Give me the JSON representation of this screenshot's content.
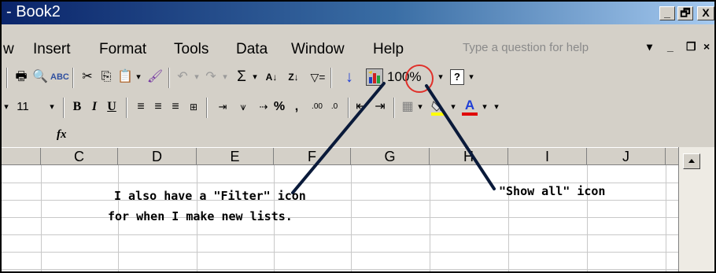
{
  "window": {
    "title": "- Book2",
    "minimize": "_",
    "restore": "̸",
    "close": "X"
  },
  "menu": {
    "items": [
      "w",
      "Insert",
      "Format",
      "Tools",
      "Data",
      "Window",
      "Help"
    ],
    "help_placeholder": "Type a question for help",
    "mdi": [
      "▾",
      "_",
      "̸",
      "×"
    ]
  },
  "standard_toolbar": {
    "zoom": "100%"
  },
  "formatting_toolbar": {
    "font_size": "11",
    "bold": "B",
    "italic": "I",
    "underline": "U",
    "percent": "%",
    "comma": ",",
    "font_color": "A"
  },
  "formula_bar": {
    "fx": "fx"
  },
  "columns": [
    "C",
    "D",
    "E",
    "F",
    "G",
    "H",
    "I",
    "J"
  ],
  "annotations": {
    "filter_line1": "I also have a \"Filter\" icon",
    "filter_line2": "for when I make new lists.",
    "show_all": "\"Show all\" icon"
  },
  "colors": {
    "accent_circle": "#e0302a",
    "arrow_blue": "#1f3fd6",
    "font_color_bar": "#e00000",
    "highlight_bar": "#ffff00"
  }
}
